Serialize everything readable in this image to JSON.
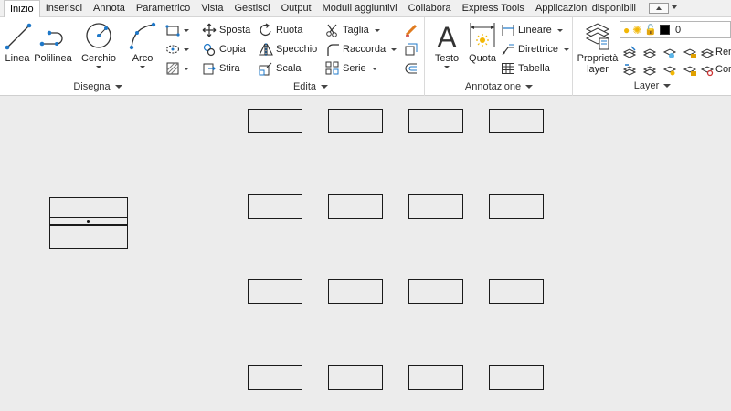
{
  "tabs": [
    {
      "label": "Inizio",
      "active": true
    },
    {
      "label": "Inserisci"
    },
    {
      "label": "Annota"
    },
    {
      "label": "Parametrico"
    },
    {
      "label": "Vista"
    },
    {
      "label": "Gestisci"
    },
    {
      "label": "Output"
    },
    {
      "label": "Moduli aggiuntivi"
    },
    {
      "label": "Collabora"
    },
    {
      "label": "Express Tools"
    },
    {
      "label": "Applicazioni disponibili"
    }
  ],
  "panels": {
    "disegna": {
      "title": "Disegna",
      "linea": "Linea",
      "polilinea": "Polilinea",
      "cerchio": "Cerchio",
      "arco": "Arco"
    },
    "edita": {
      "title": "Edita",
      "sposta": "Sposta",
      "ruota": "Ruota",
      "taglia": "Taglia",
      "copia": "Copia",
      "specchio": "Specchio",
      "raccorda": "Raccorda",
      "stira": "Stira",
      "scala": "Scala",
      "serie": "Serie"
    },
    "annotazione": {
      "title": "Annotazione",
      "testo": "Testo",
      "quota": "Quota",
      "lineare": "Lineare",
      "direttrice": "Direttrice",
      "tabella": "Tabella"
    },
    "layer": {
      "title": "Layer",
      "proprieta_line1": "Proprietà",
      "proprieta_line2": "layer",
      "current_layer": "0",
      "rename_partial": "Ren",
      "copy_partial": "Cor"
    }
  },
  "colors": {
    "accent_blue": "#1f78c8",
    "canvas": "#ececec",
    "ribbon": "#ffffff"
  }
}
